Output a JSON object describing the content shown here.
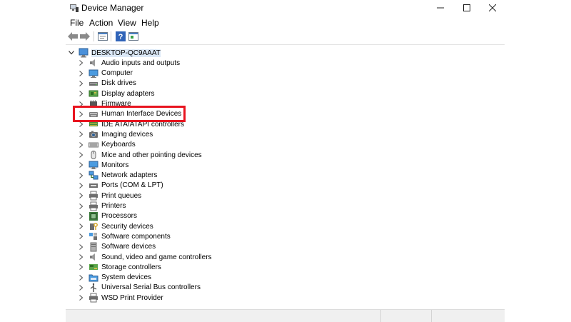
{
  "window": {
    "title": "Device Manager"
  },
  "menu": [
    {
      "label": "File"
    },
    {
      "label": "Action"
    },
    {
      "label": "View"
    },
    {
      "label": "Help"
    }
  ],
  "toolbar": [
    {
      "icon": "back-arrow-icon"
    },
    {
      "icon": "forward-arrow-icon"
    },
    {
      "icon": "properties-icon"
    },
    {
      "icon": "help-icon"
    },
    {
      "icon": "update-driver-icon"
    }
  ],
  "tree": {
    "root": {
      "label": "DESKTOP-QC9AAAT",
      "icon": "computer-icon"
    },
    "items": [
      {
        "label": "Audio inputs and outputs",
        "icon": "speaker-icon"
      },
      {
        "label": "Computer",
        "icon": "monitor-icon"
      },
      {
        "label": "Disk drives",
        "icon": "disk-drive-icon"
      },
      {
        "label": "Display adapters",
        "icon": "display-adapter-icon"
      },
      {
        "label": "Firmware",
        "icon": "firmware-icon"
      },
      {
        "label": "Human Interface Devices",
        "icon": "hid-icon"
      },
      {
        "label": "IDE ATA/ATAPI controllers",
        "icon": "ide-controller-icon"
      },
      {
        "label": "Imaging devices",
        "icon": "camera-icon"
      },
      {
        "label": "Keyboards",
        "icon": "keyboard-icon"
      },
      {
        "label": "Mice and other pointing devices",
        "icon": "mouse-icon"
      },
      {
        "label": "Monitors",
        "icon": "monitor-icon"
      },
      {
        "label": "Network adapters",
        "icon": "network-icon"
      },
      {
        "label": "Ports (COM & LPT)",
        "icon": "port-icon"
      },
      {
        "label": "Print queues",
        "icon": "printer-icon"
      },
      {
        "label": "Printers",
        "icon": "printer-icon"
      },
      {
        "label": "Processors",
        "icon": "processor-icon"
      },
      {
        "label": "Security devices",
        "icon": "security-key-icon"
      },
      {
        "label": "Software components",
        "icon": "software-component-icon"
      },
      {
        "label": "Software devices",
        "icon": "software-device-icon"
      },
      {
        "label": "Sound, video and game controllers",
        "icon": "speaker-icon"
      },
      {
        "label": "Storage controllers",
        "icon": "storage-controller-icon"
      },
      {
        "label": "System devices",
        "icon": "system-folder-icon"
      },
      {
        "label": "Universal Serial Bus controllers",
        "icon": "usb-icon"
      },
      {
        "label": "WSD Print Provider",
        "icon": "printer-icon"
      }
    ]
  },
  "highlighted_item": "Human Interface Devices"
}
